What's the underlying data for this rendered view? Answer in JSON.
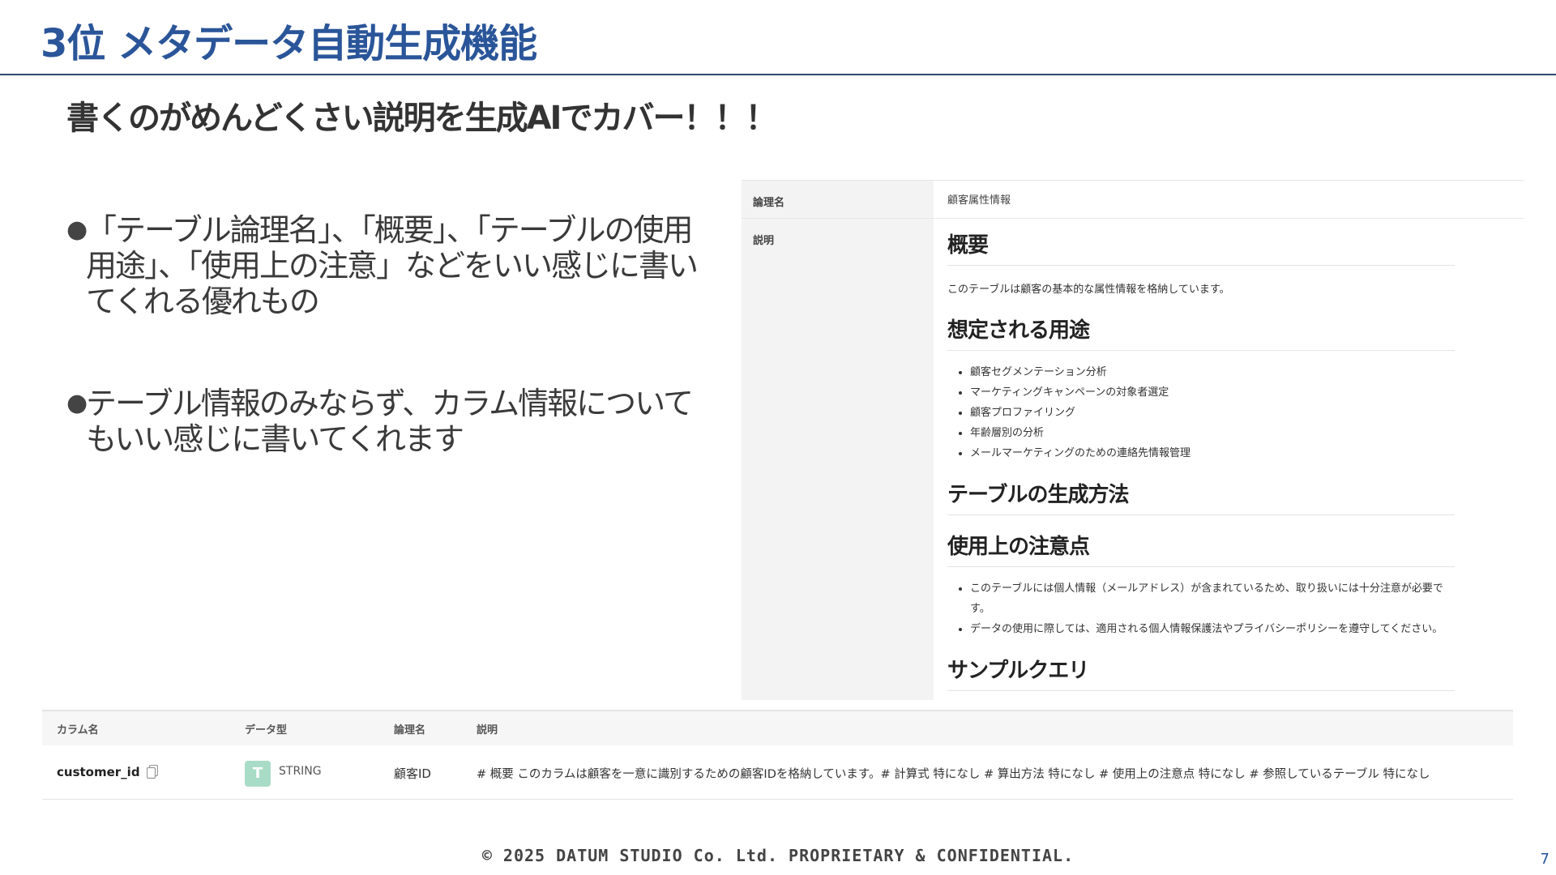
{
  "slide": {
    "title": "3位 メタデータ自動生成機能",
    "subtitle": "書くのがめんどくさい説明を生成AIでカバー！！！",
    "bullets": [
      "「テーブル論理名」、「概要」、「テーブルの使用用途」、「使用上の注意」などをいい感じに書いてくれる優れもの",
      "テーブル情報のみならず、カラム情報についてもいい感じに書いてくれます"
    ]
  },
  "table_meta": {
    "logical_name_label": "論理名",
    "logical_name_value": "顧客属性情報",
    "description_label": "説明",
    "description": {
      "overview_heading": "概要",
      "overview_text": "このテーブルは顧客の基本的な属性情報を格納しています。",
      "usage_heading": "想定される用途",
      "usage_items": [
        "顧客セグメンテーション分析",
        "マーケティングキャンペーンの対象者選定",
        "顧客プロファイリング",
        "年齢層別の分析",
        "メールマーケティングのための連絡先情報管理"
      ],
      "generation_heading": "テーブルの生成方法",
      "caution_heading": "使用上の注意点",
      "caution_items": [
        "このテーブルには個人情報（メールアドレス）が含まれているため、取り扱いには十分注意が必要です。",
        "データの使用に際しては、適用される個人情報保護法やプライバシーポリシーを遵守してください。"
      ],
      "sample_query_heading": "サンプルクエリ"
    }
  },
  "column_table": {
    "headers": {
      "name": "カラム名",
      "type": "データ型",
      "logical": "論理名",
      "description": "説明"
    },
    "rows": [
      {
        "name": "customer_id",
        "type_badge": "T",
        "type_badge_color": "#a9dcc7",
        "type": "STRING",
        "logical": "顧客ID",
        "description": "# 概要 このカラムは顧客を一意に識別するための顧客IDを格納しています。# 計算式 特になし # 算出方法 特になし # 使用上の注意点 特になし # 参照しているテーブル 特になし"
      }
    ]
  },
  "footer": "© 2025 DATUM STUDIO Co. Ltd. PROPRIETARY & CONFIDENTIAL.",
  "page_number": "7",
  "colors": {
    "title": "#2a5599",
    "rule": "#2d4a6e"
  }
}
